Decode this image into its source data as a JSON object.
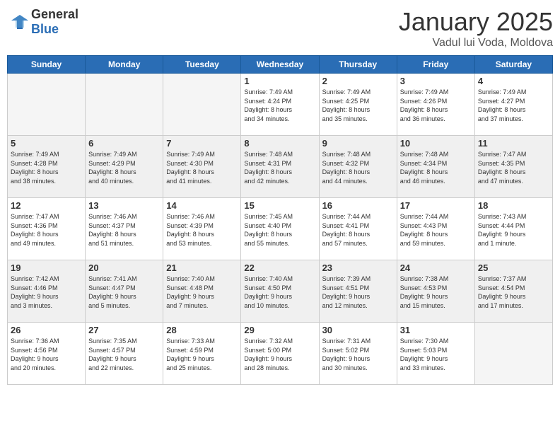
{
  "header": {
    "logo_general": "General",
    "logo_blue": "Blue",
    "month_title": "January 2025",
    "location": "Vadul lui Voda, Moldova"
  },
  "days_of_week": [
    "Sunday",
    "Monday",
    "Tuesday",
    "Wednesday",
    "Thursday",
    "Friday",
    "Saturday"
  ],
  "weeks": [
    [
      {
        "day": "",
        "info": "",
        "empty": true
      },
      {
        "day": "",
        "info": "",
        "empty": true
      },
      {
        "day": "",
        "info": "",
        "empty": true
      },
      {
        "day": "1",
        "info": "Sunrise: 7:49 AM\nSunset: 4:24 PM\nDaylight: 8 hours\nand 34 minutes.",
        "empty": false
      },
      {
        "day": "2",
        "info": "Sunrise: 7:49 AM\nSunset: 4:25 PM\nDaylight: 8 hours\nand 35 minutes.",
        "empty": false
      },
      {
        "day": "3",
        "info": "Sunrise: 7:49 AM\nSunset: 4:26 PM\nDaylight: 8 hours\nand 36 minutes.",
        "empty": false
      },
      {
        "day": "4",
        "info": "Sunrise: 7:49 AM\nSunset: 4:27 PM\nDaylight: 8 hours\nand 37 minutes.",
        "empty": false
      }
    ],
    [
      {
        "day": "5",
        "info": "Sunrise: 7:49 AM\nSunset: 4:28 PM\nDaylight: 8 hours\nand 38 minutes.",
        "empty": false
      },
      {
        "day": "6",
        "info": "Sunrise: 7:49 AM\nSunset: 4:29 PM\nDaylight: 8 hours\nand 40 minutes.",
        "empty": false
      },
      {
        "day": "7",
        "info": "Sunrise: 7:49 AM\nSunset: 4:30 PM\nDaylight: 8 hours\nand 41 minutes.",
        "empty": false
      },
      {
        "day": "8",
        "info": "Sunrise: 7:48 AM\nSunset: 4:31 PM\nDaylight: 8 hours\nand 42 minutes.",
        "empty": false
      },
      {
        "day": "9",
        "info": "Sunrise: 7:48 AM\nSunset: 4:32 PM\nDaylight: 8 hours\nand 44 minutes.",
        "empty": false
      },
      {
        "day": "10",
        "info": "Sunrise: 7:48 AM\nSunset: 4:34 PM\nDaylight: 8 hours\nand 46 minutes.",
        "empty": false
      },
      {
        "day": "11",
        "info": "Sunrise: 7:47 AM\nSunset: 4:35 PM\nDaylight: 8 hours\nand 47 minutes.",
        "empty": false
      }
    ],
    [
      {
        "day": "12",
        "info": "Sunrise: 7:47 AM\nSunset: 4:36 PM\nDaylight: 8 hours\nand 49 minutes.",
        "empty": false
      },
      {
        "day": "13",
        "info": "Sunrise: 7:46 AM\nSunset: 4:37 PM\nDaylight: 8 hours\nand 51 minutes.",
        "empty": false
      },
      {
        "day": "14",
        "info": "Sunrise: 7:46 AM\nSunset: 4:39 PM\nDaylight: 8 hours\nand 53 minutes.",
        "empty": false
      },
      {
        "day": "15",
        "info": "Sunrise: 7:45 AM\nSunset: 4:40 PM\nDaylight: 8 hours\nand 55 minutes.",
        "empty": false
      },
      {
        "day": "16",
        "info": "Sunrise: 7:44 AM\nSunset: 4:41 PM\nDaylight: 8 hours\nand 57 minutes.",
        "empty": false
      },
      {
        "day": "17",
        "info": "Sunrise: 7:44 AM\nSunset: 4:43 PM\nDaylight: 8 hours\nand 59 minutes.",
        "empty": false
      },
      {
        "day": "18",
        "info": "Sunrise: 7:43 AM\nSunset: 4:44 PM\nDaylight: 9 hours\nand 1 minute.",
        "empty": false
      }
    ],
    [
      {
        "day": "19",
        "info": "Sunrise: 7:42 AM\nSunset: 4:46 PM\nDaylight: 9 hours\nand 3 minutes.",
        "empty": false
      },
      {
        "day": "20",
        "info": "Sunrise: 7:41 AM\nSunset: 4:47 PM\nDaylight: 9 hours\nand 5 minutes.",
        "empty": false
      },
      {
        "day": "21",
        "info": "Sunrise: 7:40 AM\nSunset: 4:48 PM\nDaylight: 9 hours\nand 7 minutes.",
        "empty": false
      },
      {
        "day": "22",
        "info": "Sunrise: 7:40 AM\nSunset: 4:50 PM\nDaylight: 9 hours\nand 10 minutes.",
        "empty": false
      },
      {
        "day": "23",
        "info": "Sunrise: 7:39 AM\nSunset: 4:51 PM\nDaylight: 9 hours\nand 12 minutes.",
        "empty": false
      },
      {
        "day": "24",
        "info": "Sunrise: 7:38 AM\nSunset: 4:53 PM\nDaylight: 9 hours\nand 15 minutes.",
        "empty": false
      },
      {
        "day": "25",
        "info": "Sunrise: 7:37 AM\nSunset: 4:54 PM\nDaylight: 9 hours\nand 17 minutes.",
        "empty": false
      }
    ],
    [
      {
        "day": "26",
        "info": "Sunrise: 7:36 AM\nSunset: 4:56 PM\nDaylight: 9 hours\nand 20 minutes.",
        "empty": false
      },
      {
        "day": "27",
        "info": "Sunrise: 7:35 AM\nSunset: 4:57 PM\nDaylight: 9 hours\nand 22 minutes.",
        "empty": false
      },
      {
        "day": "28",
        "info": "Sunrise: 7:33 AM\nSunset: 4:59 PM\nDaylight: 9 hours\nand 25 minutes.",
        "empty": false
      },
      {
        "day": "29",
        "info": "Sunrise: 7:32 AM\nSunset: 5:00 PM\nDaylight: 9 hours\nand 28 minutes.",
        "empty": false
      },
      {
        "day": "30",
        "info": "Sunrise: 7:31 AM\nSunset: 5:02 PM\nDaylight: 9 hours\nand 30 minutes.",
        "empty": false
      },
      {
        "day": "31",
        "info": "Sunrise: 7:30 AM\nSunset: 5:03 PM\nDaylight: 9 hours\nand 33 minutes.",
        "empty": false
      },
      {
        "day": "",
        "info": "",
        "empty": true
      }
    ]
  ]
}
